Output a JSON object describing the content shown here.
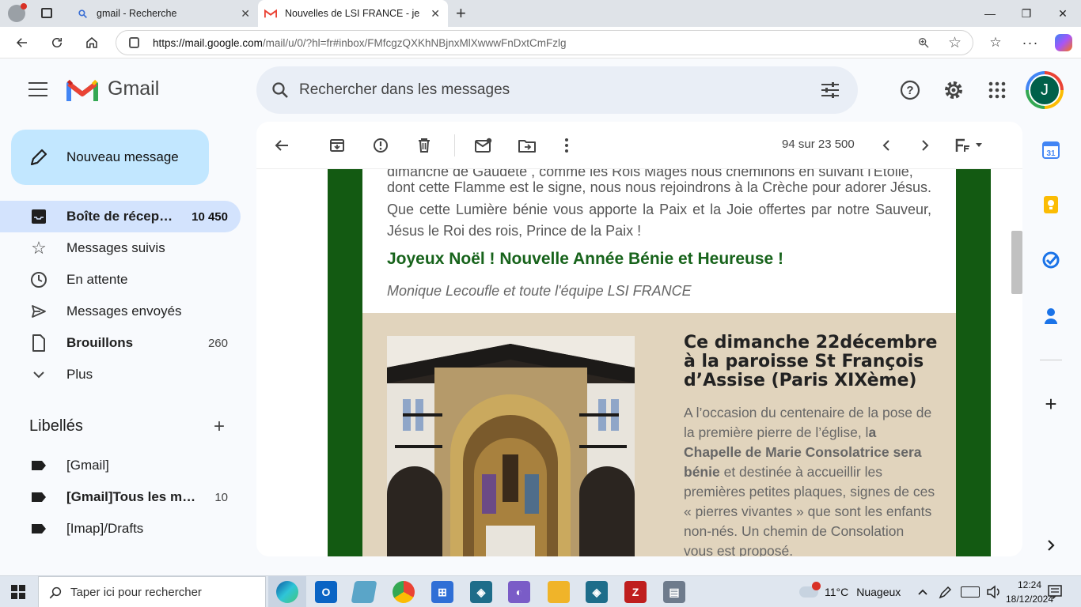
{
  "browser": {
    "tabs": [
      {
        "title": "gmail - Recherche"
      },
      {
        "title": "Nouvelles de LSI FRANCE - jeanyv"
      }
    ],
    "url_host": "https://mail.google.com",
    "url_path": "/mail/u/0/?hl=fr#inbox/FMfcgzQXKhNBjnxMlXwwwFnDxtCmFzlg"
  },
  "gmail": {
    "brand": "Gmail",
    "search_placeholder": "Rechercher dans les messages",
    "avatar_letter": "J",
    "compose_label": "Nouveau message",
    "nav": [
      {
        "label": "Boîte de récep…",
        "count": "10 450"
      },
      {
        "label": "Messages suivis",
        "count": ""
      },
      {
        "label": "En attente",
        "count": ""
      },
      {
        "label": "Messages envoyés",
        "count": ""
      },
      {
        "label": "Brouillons",
        "count": "260"
      },
      {
        "label": "Plus",
        "count": ""
      }
    ],
    "labels_header": "Libellés",
    "labels": [
      {
        "label": "[Gmail]",
        "count": ""
      },
      {
        "label": "[Gmail]Tous les m…",
        "count": "10"
      },
      {
        "label": "[Imap]/Drafts",
        "count": ""
      }
    ],
    "toolbar_count": "94 sur 23 500",
    "icons": [
      "back-icon",
      "archive-icon",
      "report-spam-icon",
      "delete-icon",
      "mark-unread-icon",
      "move-to-icon",
      "more-vert-icon",
      "chevron-left-icon",
      "chevron-right-icon",
      "font-size-icon"
    ]
  },
  "email": {
    "cut_line": "dimanche de Gaudete , comme les Rois Mages nous cheminons en suivant l'Etoile,",
    "paragraph": "dont cette Flamme est le signe, nous nous rejoindrons à la Crèche pour adorer Jésus. Que cette Lumière bénie vous apporte la Paix et la Joie offertes par notre Sauveur, Jésus le Roi des rois, Prince de la Paix !",
    "greeting": "Joyeux  Noël ! Nouvelle Année Bénie et Heureuse !",
    "signature": "Monique Lecoufle et toute l'équipe LSI FRANCE",
    "event_title": "Ce dimanche 22décembre à la paroisse St François d’Assise (Paris XIXème)",
    "event_text_1": "A l’occasion du centenaire de la pose de la première pierre de l’église, l",
    "event_text_bold": "a Chapelle de Marie Consolatrice sera bénie",
    "event_text_2": " et destinée à accueillir les premières petites plaques, signes de ces « pierres vivantes » que sont les enfants non-nés. Un chemin de Consolation vous est proposé.",
    "colors": {
      "frame_green": "#135a12",
      "greeting_green": "#17631b",
      "beige": "#e1d4bd"
    }
  },
  "taskbar": {
    "search_placeholder": "Taper ici pour rechercher",
    "weather_temp": "11°C",
    "weather_text": "Nuageux",
    "time": "12:24",
    "date": "18/12/2024"
  }
}
